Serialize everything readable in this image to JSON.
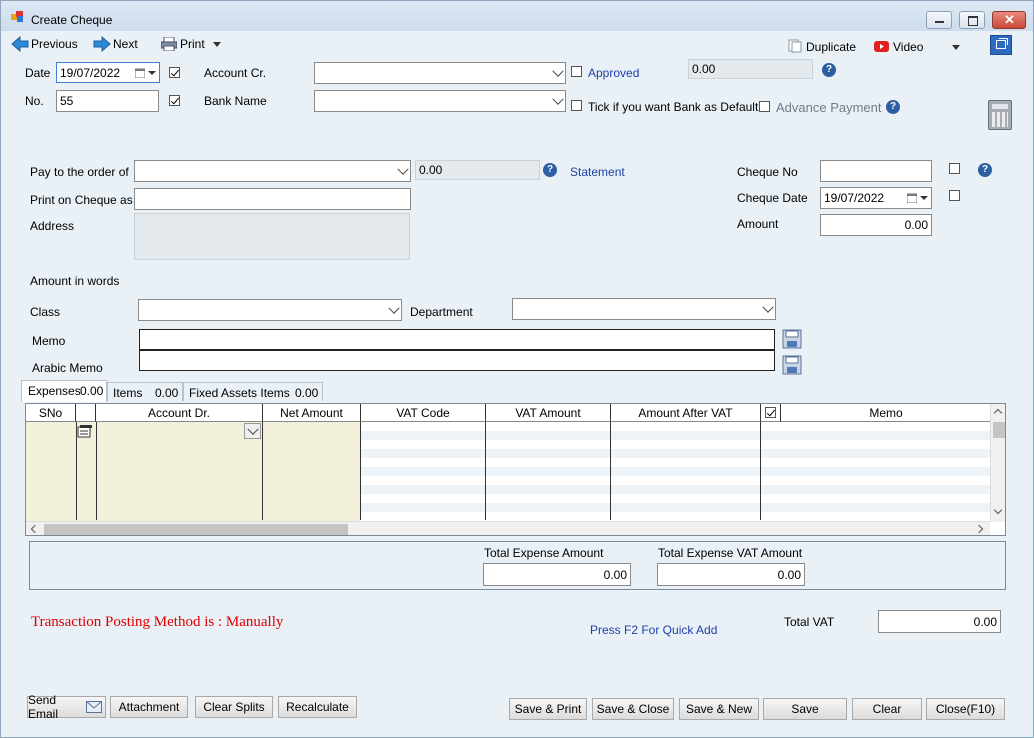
{
  "window": {
    "title": "Create Cheque"
  },
  "toolbar": {
    "previous": "Previous",
    "next": "Next",
    "print": "Print",
    "duplicate": "Duplicate",
    "video": "Video"
  },
  "header": {
    "date_label": "Date",
    "date_value": "19/07/2022",
    "no_label": "No.",
    "no_value": "55",
    "account_cr_label": "Account Cr.",
    "bank_name_label": "Bank Name",
    "approved_label": "Approved",
    "balance_value": "0.00",
    "bank_default_label": "Tick if you want Bank as Default",
    "advance_payment_label": "Advance Payment"
  },
  "payee": {
    "pay_to_label": "Pay to the order of",
    "pay_to_balance": "0.00",
    "statement_link": "Statement",
    "print_on_cheque_label": "Print on Cheque as",
    "address_label": "Address",
    "amount_in_words_label": "Amount in words"
  },
  "cheque": {
    "cheque_no_label": "Cheque No",
    "cheque_date_label": "Cheque Date",
    "cheque_date_value": "19/07/2022",
    "amount_label": "Amount",
    "amount_value": "0.00"
  },
  "classification": {
    "class_label": "Class",
    "department_label": "Department",
    "memo_label": "Memo",
    "arabic_memo_label": "Arabic Memo"
  },
  "tabs": [
    {
      "label": "Expenses",
      "value": "0.00"
    },
    {
      "label": "Items",
      "value": "0.00"
    },
    {
      "label": "Fixed Assets Items",
      "value": "0.00"
    }
  ],
  "grid": {
    "columns": [
      "SNo",
      "",
      "Account Dr.",
      "Net Amount",
      "VAT Code",
      "VAT Amount",
      "Amount After VAT",
      "",
      "Memo"
    ]
  },
  "totals": {
    "total_expense_label": "Total Expense Amount",
    "total_expense_value": "0.00",
    "total_vat_amount_label": "Total Expense VAT Amount",
    "total_vat_amount_value": "0.00",
    "total_vat_label": "Total VAT",
    "total_vat_value": "0.00"
  },
  "status": {
    "posting_method": "Transaction Posting Method is : Manually",
    "quick_add": "Press F2 For Quick Add"
  },
  "footer": {
    "send_email": "Send Email",
    "attachment": "Attachment",
    "clear_splits": "Clear Splits",
    "recalculate": "Recalculate",
    "save_print": "Save & Print",
    "save_close": "Save & Close",
    "save_new": "Save & New",
    "save": "Save",
    "clear": "Clear",
    "close": "Close(F10)"
  },
  "colors": {
    "accent": "#1f3fa8",
    "error_text": "#e00000",
    "grid_shade": "#f3f1dc"
  }
}
